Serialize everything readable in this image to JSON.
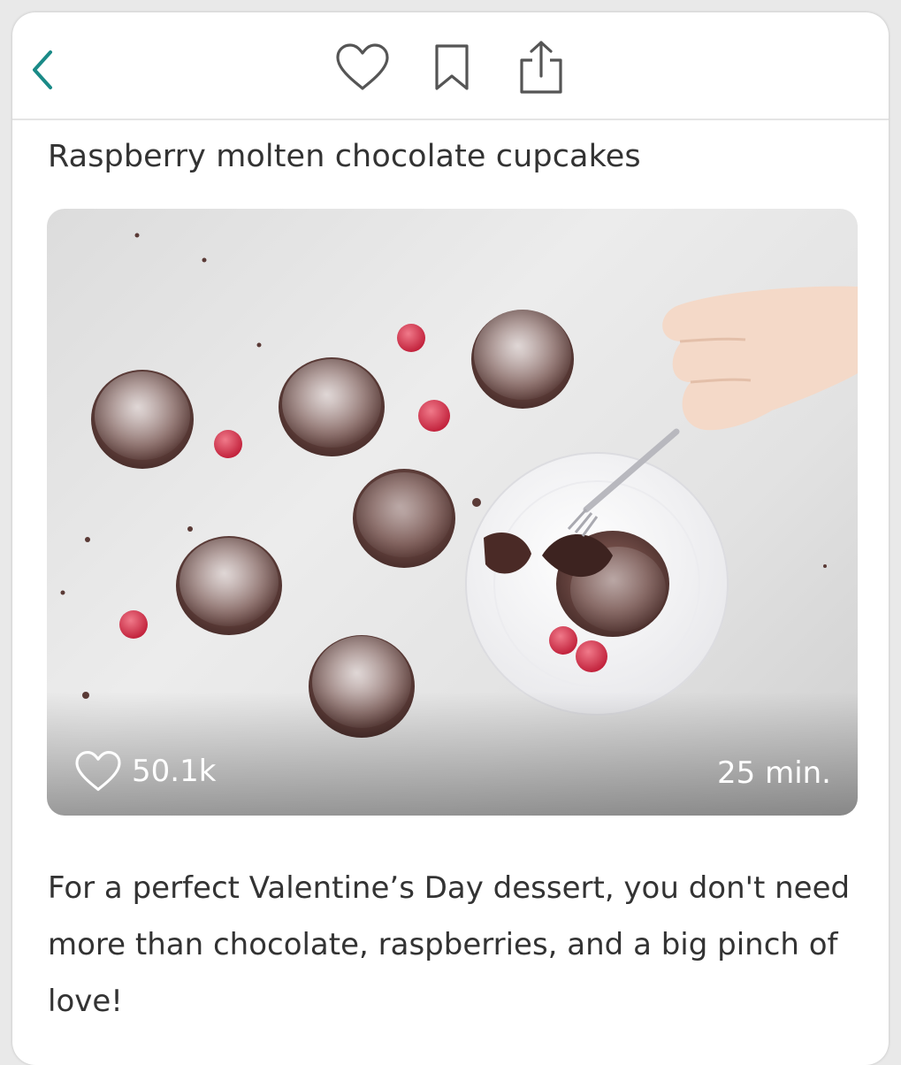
{
  "recipe": {
    "title": "Raspberry molten chocolate cupcakes",
    "likes": "50.1k",
    "time": "25 min.",
    "description": "For a perfect Valentine’s Day dessert, you don't need more than chocolate, raspberries, and a big pinch of love!"
  },
  "toolbar": {
    "back_icon": "chevron-left-icon",
    "like_icon": "heart-outline-icon",
    "save_icon": "bookmark-outline-icon",
    "share_icon": "share-icon"
  },
  "colors": {
    "accent": "#1a8a87",
    "text": "#333333",
    "icon": "#555555",
    "divider": "#e4e4e4"
  }
}
